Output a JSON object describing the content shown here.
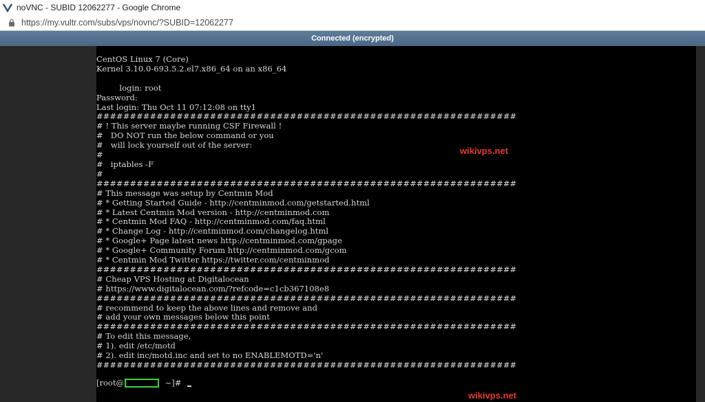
{
  "window": {
    "title": "noVNC - SUBID 12062277 - Google Chrome",
    "url": "https://my.vultr.com/subs/vps/novnc/?SUBID=12062277"
  },
  "vnc": {
    "status": "Connected (encrypted)"
  },
  "terminal": {
    "text": "CentOS Linux 7 (Core)\nKernel 3.10.0-693.5.2.el7.x86_64 on an x86_64\n\n         login: root\nPassword:\nLast login: Thu Oct 11 07:12:08 on tty1\n###############################################################\n# ! This server maybe running CSF Firewall !\n#   DO NOT run the below command or you\n#   will lock yourself out of the server:\n#\n#   iptables -F\n#\n###############################################################\n# This message was setup by Centmin Mod\n# * Getting Started Guide - http://centminmod.com/getstarted.html\n# * Latest Centmin Mod version - http://centminmod.com\n# * Centmin Mod FAQ - http://centminmod.com/faq.html\n# * Change Log - http://centminmod.com/changelog.html\n# * Google+ Page latest news http://centminmod.com/gpage\n# * Google+ Community Forum http://centminmod.com/gcom\n# * Centmin Mod Twitter https://twitter.com/centminmod\n###############################################################\n# Cheap VPS Hosting at Digitalocean\n# https://www.digitalocean.com/?refcode=c1cb367108e8\n###############################################################\n# recommend to keep the above lines and remove and\n# add your own messages below this point\n###############################################################\n# To edit this message,\n# 1). edit /etc/motd\n# 2). edit inc/motd.inc and set to no ENABLEMOTD='n'\n###############################################################",
    "prompt_prefix": "[root@",
    "prompt_suffix": " ~]# "
  },
  "watermarks": [
    "wikivps.net",
    "wikivps.net"
  ],
  "colors": {
    "status_bar": "#4a6886",
    "terminal_bg": "#000000",
    "terminal_fg": "#d8d8d8",
    "redaction_box": "#3bd43b",
    "watermark": "#e23c2f"
  },
  "icons": {
    "app": "novnc-logo-icon",
    "security": "lock-icon"
  }
}
